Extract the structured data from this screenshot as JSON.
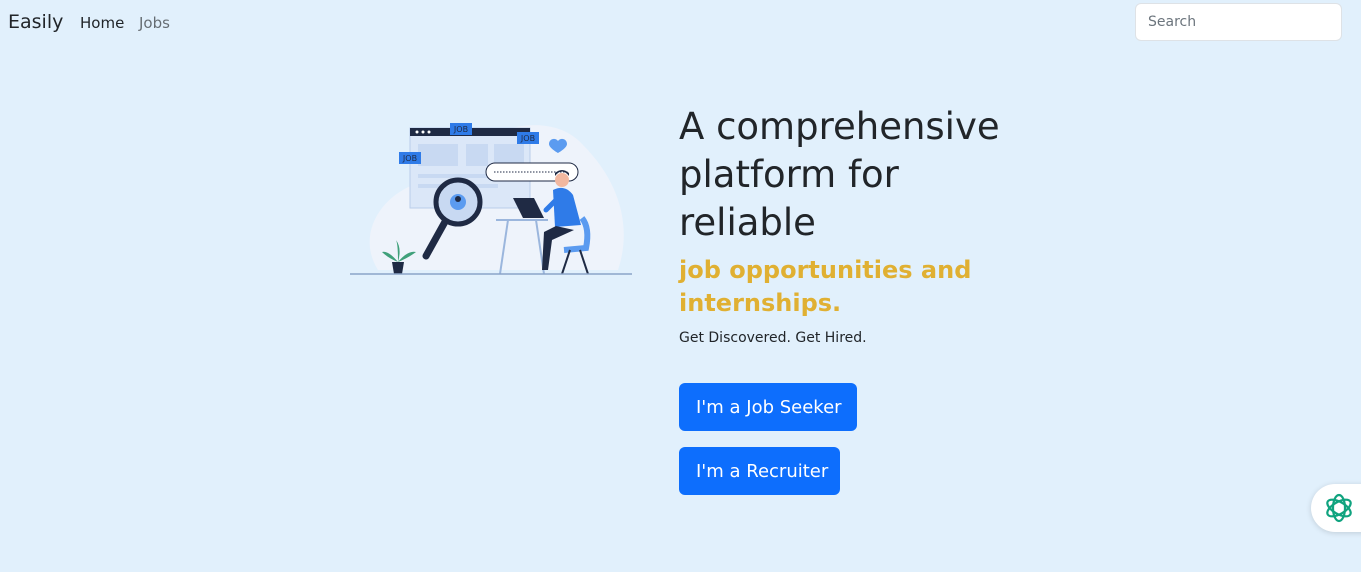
{
  "navbar": {
    "brand": "Easily",
    "links": [
      {
        "label": "Home"
      },
      {
        "label": "Jobs"
      }
    ],
    "search": {
      "placeholder": "Search",
      "value": ""
    }
  },
  "hero": {
    "illustration": {
      "tags": [
        "JOB",
        "JOB",
        "JOB"
      ]
    },
    "headline": "A comprehensive platform for reliable",
    "subheadline": "job opportunities and internships.",
    "tagline": "Get Discovered. Get Hired.",
    "buttons": {
      "seeker": "I'm a Job Seeker",
      "recruiter": "I'm a Recruiter"
    }
  },
  "widget": {
    "icon": "openai-knot-icon"
  },
  "colors": {
    "background": "#e1f0fc",
    "primary": "#0d6efd",
    "accent": "#e0b032",
    "text": "#212529"
  }
}
